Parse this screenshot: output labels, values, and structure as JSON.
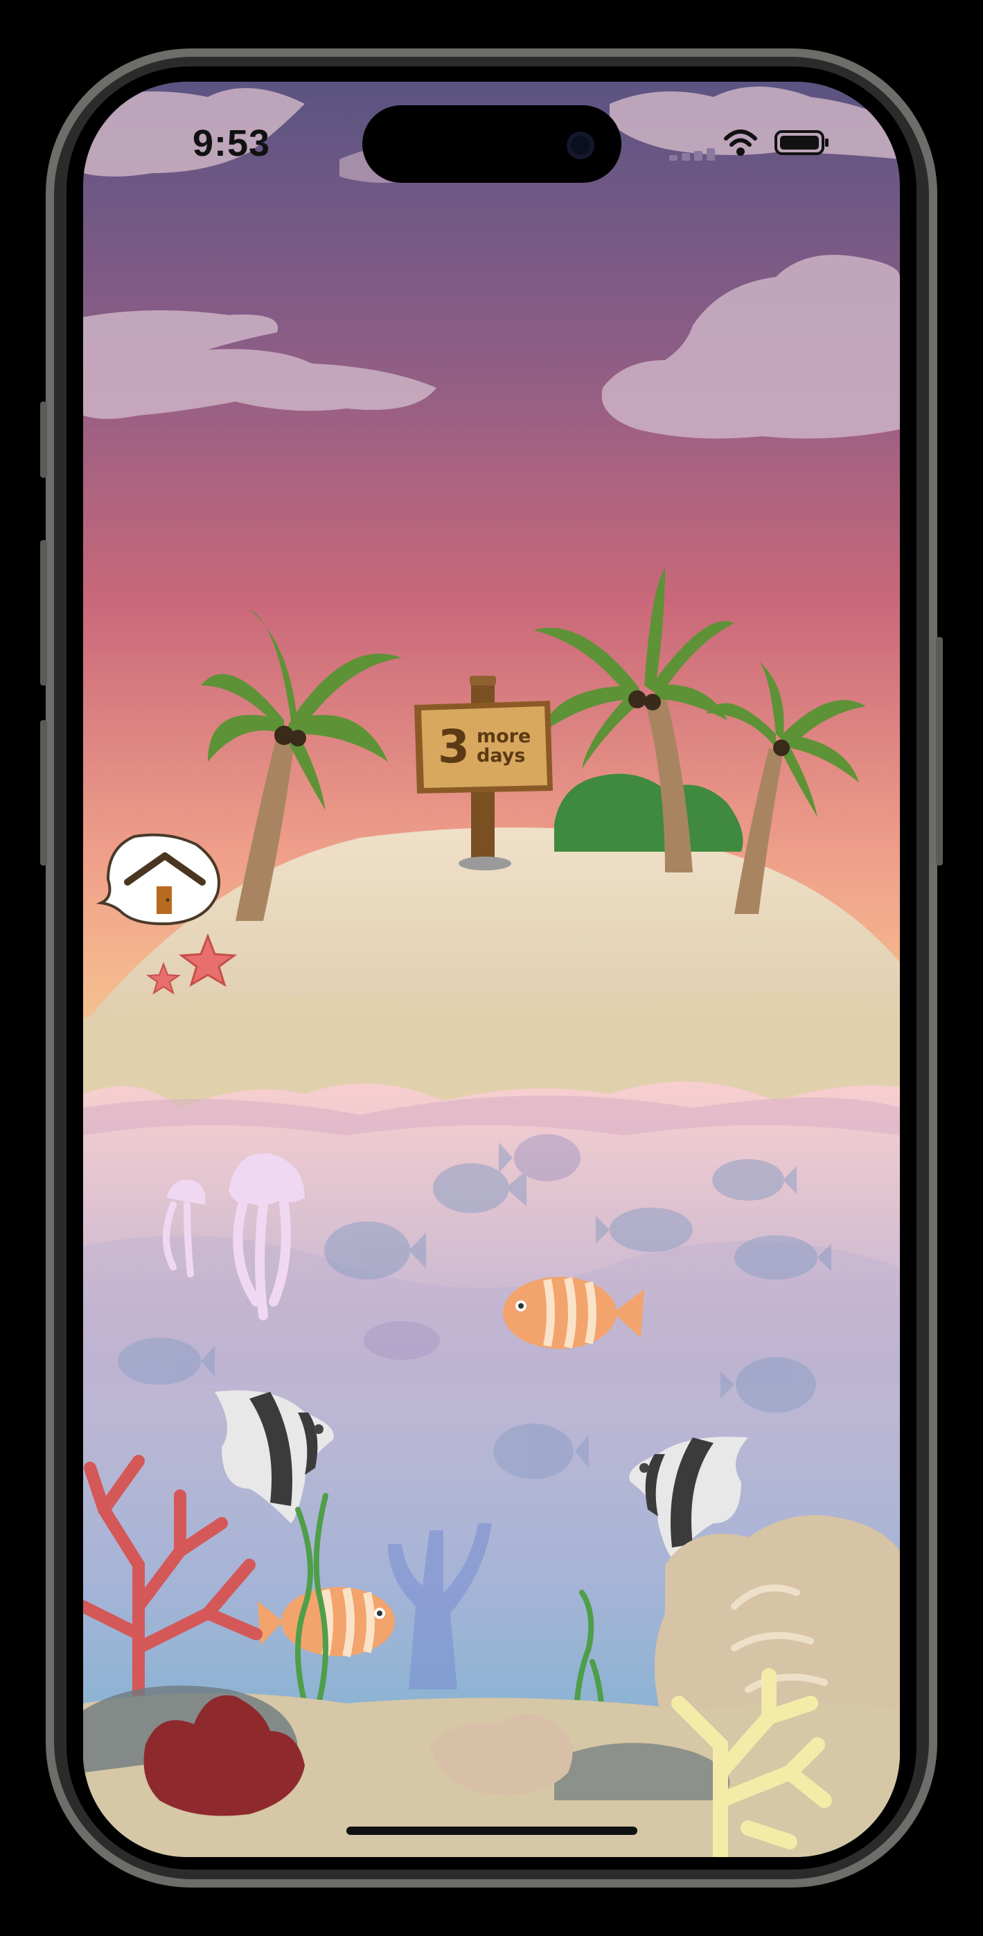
{
  "status_bar": {
    "time": "9:53",
    "icons": [
      "signal-icon",
      "wifi-icon",
      "battery-icon"
    ]
  },
  "sign": {
    "number": "3",
    "line1": "more",
    "line2": "days"
  },
  "home_button": {
    "icon": "home-icon"
  },
  "colors": {
    "sky_top": "#5b5482",
    "sky_mid": "#c9687a",
    "sky_horizon": "#f5c78a",
    "sand": "#e8d6b6",
    "water_top": "#f8cfcf",
    "water_bottom": "#7fb6d6",
    "sign_wood": "#d9a85f"
  }
}
